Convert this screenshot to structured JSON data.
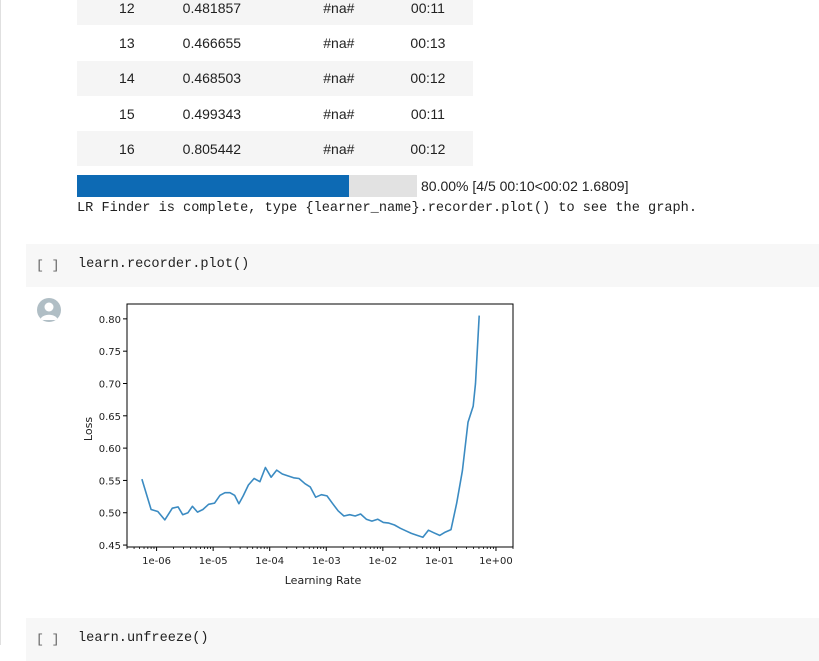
{
  "training_table": {
    "rows": [
      {
        "epoch": "12",
        "train_loss": "0.481857",
        "valid_loss": "#na#",
        "time": "00:11"
      },
      {
        "epoch": "13",
        "train_loss": "0.466655",
        "valid_loss": "#na#",
        "time": "00:13"
      },
      {
        "epoch": "14",
        "train_loss": "0.468503",
        "valid_loss": "#na#",
        "time": "00:12"
      },
      {
        "epoch": "15",
        "train_loss": "0.499343",
        "valid_loss": "#na#",
        "time": "00:11"
      },
      {
        "epoch": "16",
        "train_loss": "0.805442",
        "valid_loss": "#na#",
        "time": "00:12"
      }
    ]
  },
  "progress": {
    "fraction": 0.8,
    "text": "80.00% [4/5 00:10<00:02 1.6809]"
  },
  "lr_finder_message": "LR Finder is complete, type {learner_name}.recorder.plot() to see the graph.",
  "cells": [
    {
      "prompt": "[ ]",
      "code": "learn.recorder.plot()"
    },
    {
      "prompt": "[ ]",
      "code": "learn.unfreeze()"
    }
  ],
  "icons": {
    "output": "user-avatar-icon"
  },
  "colors": {
    "progress_fill": "#0d6ab4",
    "line": "#3b8bc2",
    "cell_bg": "#f7f7f7"
  },
  "chart_data": {
    "type": "line",
    "title": "",
    "xlabel": "Learning Rate",
    "ylabel": "Loss",
    "xscale": "log",
    "xlim": [
      3e-07,
      2.0
    ],
    "ylim": [
      0.447,
      0.823
    ],
    "xticks": [
      1e-06,
      1e-05,
      0.0001,
      0.001,
      0.01,
      0.1,
      1
    ],
    "xtick_labels": [
      "1e-06",
      "1e-05",
      "1e-04",
      "1e-03",
      "1e-02",
      "1e-01",
      "1e+00"
    ],
    "yticks": [
      0.45,
      0.5,
      0.55,
      0.6,
      0.65,
      0.7,
      0.75,
      0.8
    ],
    "ytick_labels": [
      "0.45",
      "0.50",
      "0.55",
      "0.60",
      "0.65",
      "0.70",
      "0.75",
      "0.80"
    ],
    "grid": false,
    "series": [
      {
        "x": [
          5.5e-07,
          8e-07,
          1.05e-06,
          1.4e-06,
          1.9e-06,
          2.4e-06,
          2.9e-06,
          3.6e-06,
          4.3e-06,
          5.3e-06,
          6.6e-06,
          8.3e-06,
          1.06e-05,
          1.32e-05,
          1.62e-05,
          1.98e-05,
          2.4e-05,
          2.85e-05,
          3.4e-05,
          4.2e-05,
          5.3e-05,
          6.7e-05,
          8.4e-05,
          0.000106,
          0.000133,
          0.000167,
          0.00021,
          0.000265,
          0.00033,
          0.00042,
          0.00052,
          0.00065,
          0.00082,
          0.00103,
          0.0013,
          0.00162,
          0.00205,
          0.0026,
          0.00325,
          0.00405,
          0.0051,
          0.0064,
          0.0081,
          0.0102,
          0.0128,
          0.0161,
          0.0204,
          0.0255,
          0.032,
          0.0405,
          0.051,
          0.064,
          0.08,
          0.101,
          0.127,
          0.16,
          0.202,
          0.255,
          0.32,
          0.395,
          0.435,
          0.505
        ],
        "y": [
          0.552,
          0.505,
          0.502,
          0.489,
          0.507,
          0.509,
          0.497,
          0.5,
          0.51,
          0.501,
          0.505,
          0.513,
          0.515,
          0.527,
          0.531,
          0.531,
          0.527,
          0.514,
          0.526,
          0.543,
          0.553,
          0.548,
          0.57,
          0.555,
          0.566,
          0.56,
          0.557,
          0.554,
          0.553,
          0.545,
          0.54,
          0.524,
          0.528,
          0.526,
          0.514,
          0.503,
          0.495,
          0.497,
          0.495,
          0.498,
          0.49,
          0.487,
          0.49,
          0.485,
          0.484,
          0.481,
          0.476,
          0.472,
          0.468,
          0.465,
          0.462,
          0.473,
          0.469,
          0.465,
          0.47,
          0.474,
          0.515,
          0.565,
          0.64,
          0.665,
          0.7,
          0.805
        ]
      }
    ]
  }
}
